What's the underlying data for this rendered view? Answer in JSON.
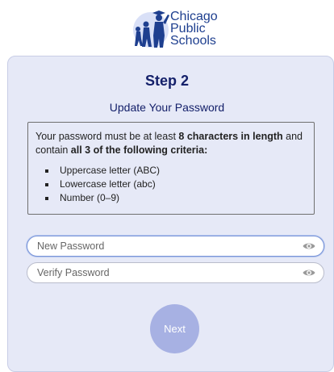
{
  "logo": {
    "line1": "Chicago",
    "line2": "Public",
    "line3": "Schools",
    "color": "#1e3f8f"
  },
  "card": {
    "step_title": "Step 2",
    "subtitle": "Update Your Password",
    "criteria": {
      "intro_prefix": "Your password must be at least ",
      "intro_bold1": "8 characters in length",
      "intro_middle": " and contain ",
      "intro_bold2": "all 3 of the following criteria:",
      "items": [
        "Uppercase letter (ABC)",
        "Lowercase letter (abc)",
        "Number (0–9)"
      ]
    },
    "new_password": {
      "placeholder": "New Password",
      "value": "",
      "icon": "eye-icon"
    },
    "verify_password": {
      "placeholder": "Verify Password",
      "value": "",
      "icon": "eye-icon"
    },
    "next_label": "Next"
  },
  "colors": {
    "card_bg": "#e6e9f7",
    "title": "#14206a",
    "button": "#a7b1e3"
  }
}
